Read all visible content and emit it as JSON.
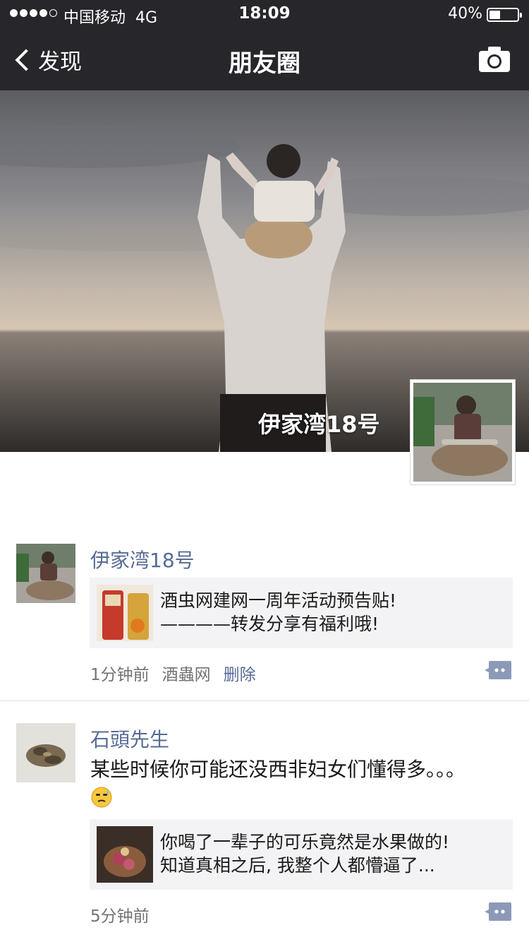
{
  "status_bar": {
    "carrier": "中国移动",
    "network": "4G",
    "time": "18:09",
    "battery": "40%",
    "battery_level": 0.4
  },
  "nav": {
    "back_label": "发现",
    "title": "朋友圈",
    "right_icon": "camera-icon"
  },
  "cover": {
    "username": "伊家湾18号"
  },
  "posts": [
    {
      "name": "伊家湾18号",
      "link_text_line1": "酒虫网建网一周年活动预告贴!",
      "link_text_line2": "————转发分享有福利哦!",
      "time": "1分钟前",
      "source": "酒蟲网",
      "delete": "删除"
    },
    {
      "name": "石頭先生",
      "text_line1": "某些时候你可能还没西非妇女们懂得多。。。",
      "emoji": "face-emoji",
      "link_text_line1": "你喝了一辈子的可乐竟然是水果做的!",
      "link_text_line2": "知道真相之后, 我整个人都懵逼了...",
      "time": "5分钟前"
    }
  ],
  "colors": {
    "nav_bg": "#26262b",
    "name_blue": "#576b95",
    "card_bg": "#f3f3f5"
  }
}
